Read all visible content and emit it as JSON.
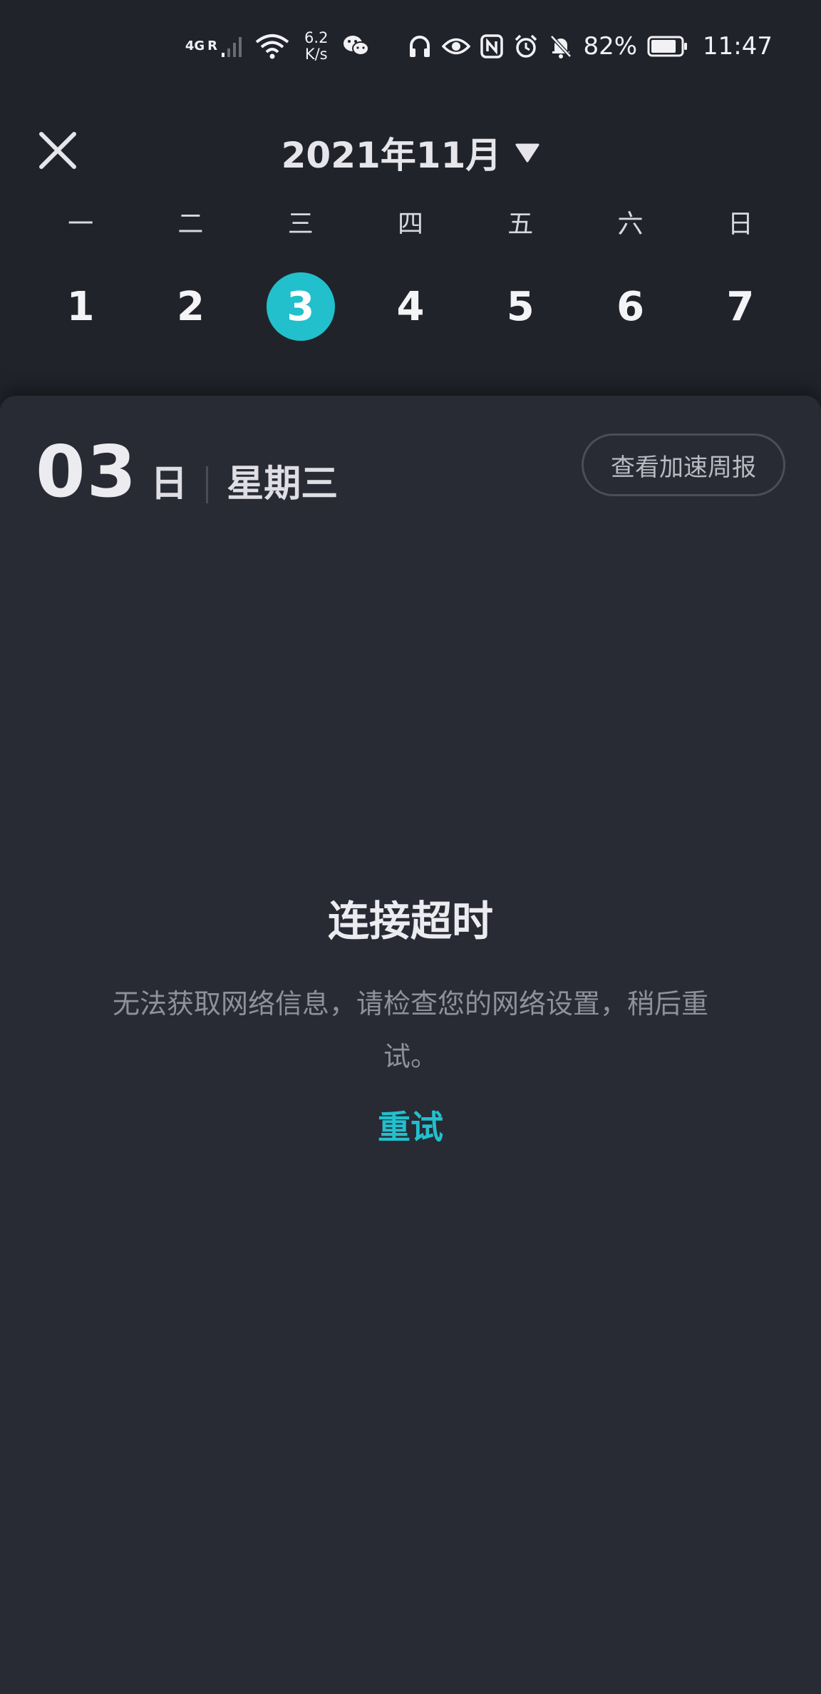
{
  "status_bar": {
    "network_type": "4G",
    "network_badge": "R",
    "speed_value": "6.2",
    "speed_unit": "K/s",
    "battery": "82%",
    "time": "11:47",
    "icons": [
      "signal-icon",
      "wifi-icon",
      "wechat-icon",
      "headphones-icon",
      "eye-icon",
      "nfc-icon",
      "alarm-icon",
      "mute-icon",
      "battery-icon"
    ]
  },
  "header": {
    "month_title": "2021年11月"
  },
  "calendar": {
    "weekdays": [
      "一",
      "二",
      "三",
      "四",
      "五",
      "六",
      "日"
    ],
    "days": [
      "1",
      "2",
      "3",
      "4",
      "5",
      "6",
      "7"
    ],
    "selected_index": 2,
    "accent_color": "#21c0cc"
  },
  "detail": {
    "day_number": "03",
    "day_unit": "日",
    "weekday_name": "星期三",
    "weekly_report_label": "查看加速周报"
  },
  "error": {
    "title": "连接超时",
    "description": "无法获取网络信息，请检查您的网络设置，稍后重试。",
    "retry_label": "重试"
  }
}
